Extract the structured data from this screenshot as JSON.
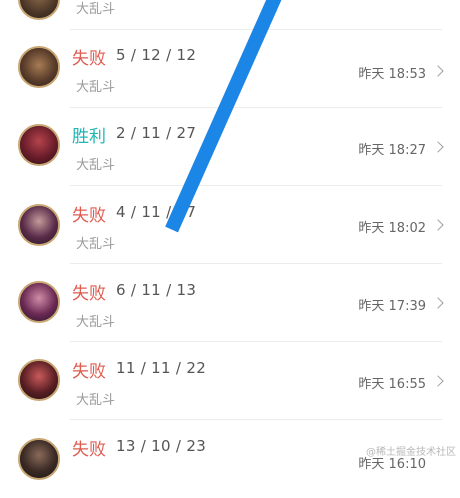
{
  "rows": [
    {
      "result": "",
      "kda": "",
      "mode": "大乱斗",
      "time": "",
      "result_type": "lose",
      "avatar_icon": "champion-portrait"
    },
    {
      "result": "失败",
      "kda": "5 / 12 / 12",
      "mode": "大乱斗",
      "time": "昨天 18:53",
      "result_type": "lose",
      "avatar_icon": "champion-portrait"
    },
    {
      "result": "胜利",
      "kda": "2 / 11 / 27",
      "mode": "大乱斗",
      "time": "昨天 18:27",
      "result_type": "win",
      "avatar_icon": "champion-portrait"
    },
    {
      "result": "失败",
      "kda": "4 / 11 / 37",
      "mode": "大乱斗",
      "time": "昨天 18:02",
      "result_type": "lose",
      "avatar_icon": "champion-portrait"
    },
    {
      "result": "失败",
      "kda": "6 / 11 / 13",
      "mode": "大乱斗",
      "time": "昨天 17:39",
      "result_type": "lose",
      "avatar_icon": "champion-portrait"
    },
    {
      "result": "失败",
      "kda": "11 / 11 / 22",
      "mode": "大乱斗",
      "time": "昨天 16:55",
      "result_type": "lose",
      "avatar_icon": "champion-portrait"
    },
    {
      "result": "失败",
      "kda": "13 / 10 / 23",
      "mode": "",
      "time": "昨天 16:10",
      "result_type": "lose",
      "avatar_icon": "champion-portrait"
    }
  ],
  "watermark": "@稀土掘金技术社区",
  "colors": {
    "lose": "#e05a4f",
    "win": "#1fb5b5",
    "stripe": "#1b86e6"
  }
}
